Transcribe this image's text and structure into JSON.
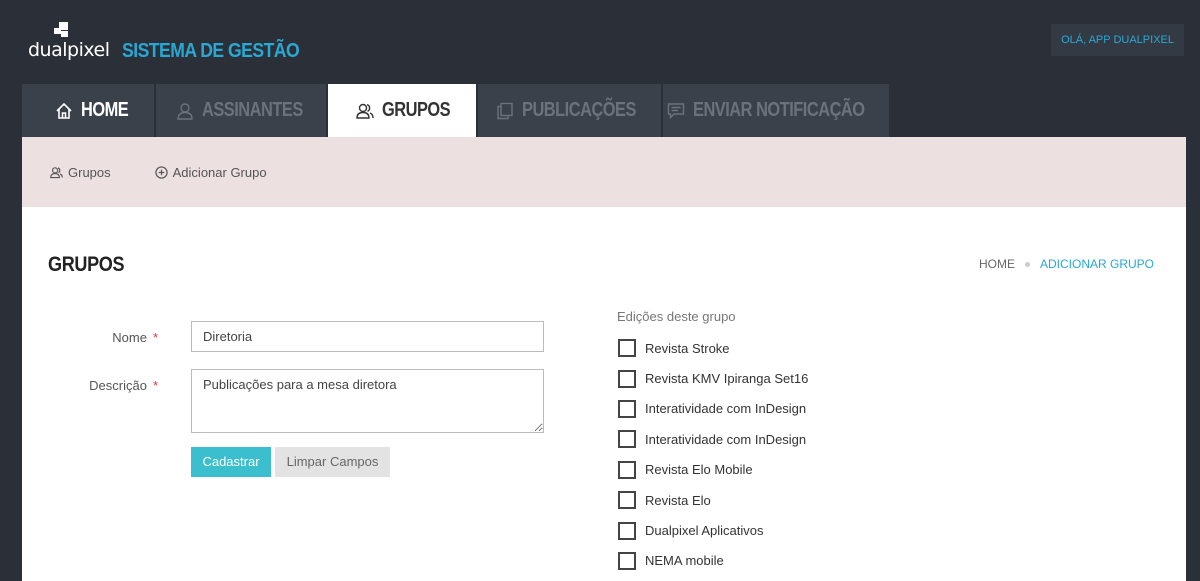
{
  "header": {
    "logo_text": "dualpixel",
    "app_title": "SISTEMA DE GESTÃO",
    "user_greeting": "OLÁ, APP DUALPIXEL"
  },
  "tabs": [
    {
      "label": "HOME",
      "icon": "home-icon"
    },
    {
      "label": "ASSINANTES",
      "icon": "user-icon"
    },
    {
      "label": "GRUPOS",
      "icon": "users-icon"
    },
    {
      "label": "PUBLICAÇÕES",
      "icon": "copy-icon"
    },
    {
      "label": "ENVIAR NOTIFICAÇÃO",
      "icon": "message-icon"
    }
  ],
  "subnav": {
    "groups_label": "Grupos",
    "add_group_label": "Adicionar Grupo"
  },
  "page": {
    "title": "GRUPOS",
    "breadcrumb_home": "HOME",
    "breadcrumb_current": "ADICIONAR GRUPO"
  },
  "form": {
    "name_label": "Nome",
    "name_value": "Diretoria",
    "description_label": "Descrição",
    "description_value": "Publicações para a mesa diretora",
    "required_mark": "*",
    "submit_label": "Cadastrar",
    "clear_label": "Limpar Campos"
  },
  "editions": {
    "title": "Edições deste grupo",
    "items": [
      "Revista Stroke",
      "Revista KMV Ipiranga Set16",
      "Interatividade com InDesign",
      "Interatividade com InDesign",
      "Revista Elo Mobile",
      "Revista Elo",
      "Dualpixel Aplicativos",
      "NEMA mobile",
      ""
    ]
  },
  "colors": {
    "background": "#2b3038",
    "accent": "#29a8d4",
    "primary_button": "#3bbfce",
    "subnav_bg": "#ede0e0",
    "required": "#e53935"
  }
}
